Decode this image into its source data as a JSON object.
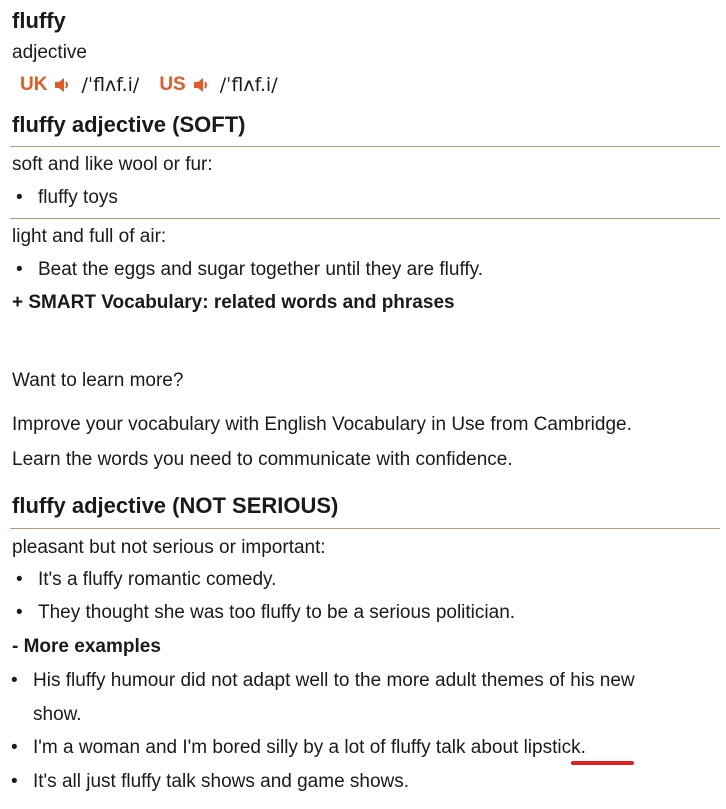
{
  "headword": "fluffy",
  "part_of_speech": "adjective",
  "pronunciations": [
    {
      "region": "UK",
      "ipa": "/ˈflʌf.i/"
    },
    {
      "region": "US",
      "ipa": "/ˈflʌf.i/"
    }
  ],
  "senses": [
    {
      "title": "fluffy adjective (SOFT)",
      "definitions": [
        {
          "text": "soft and like wool or fur:",
          "examples": [
            "fluffy toys"
          ]
        },
        {
          "text": "light and full of air:",
          "examples": [
            "Beat the eggs and sugar together until they are fluffy."
          ]
        }
      ],
      "smart_vocab": "+ SMART Vocabulary: related words and phrases"
    },
    {
      "title": "fluffy adjective (NOT SERIOUS)",
      "definitions": [
        {
          "text": "pleasant but not serious or important:",
          "examples": [
            "It's a fluffy romantic comedy.",
            "They thought she was too fluffy to be a serious politician."
          ]
        }
      ],
      "more_examples_label": "- More examples",
      "more_examples": [
        "His fluffy humour did not adapt well to the more adult themes of his new",
        "show.",
        "I'm a woman and I'm bored silly by a lot of fluffy talk about lipstick.",
        "It's all just fluffy talk shows and game shows."
      ]
    }
  ],
  "promo": {
    "heading": "Want to learn more?",
    "line1": "Improve your vocabulary with English Vocabulary in Use from Cambridge.",
    "line2": "Learn the words you need to communicate with confidence."
  },
  "colors": {
    "accent": "#e25a25",
    "rule": "#c59a6a",
    "annotation": "#e02020"
  }
}
